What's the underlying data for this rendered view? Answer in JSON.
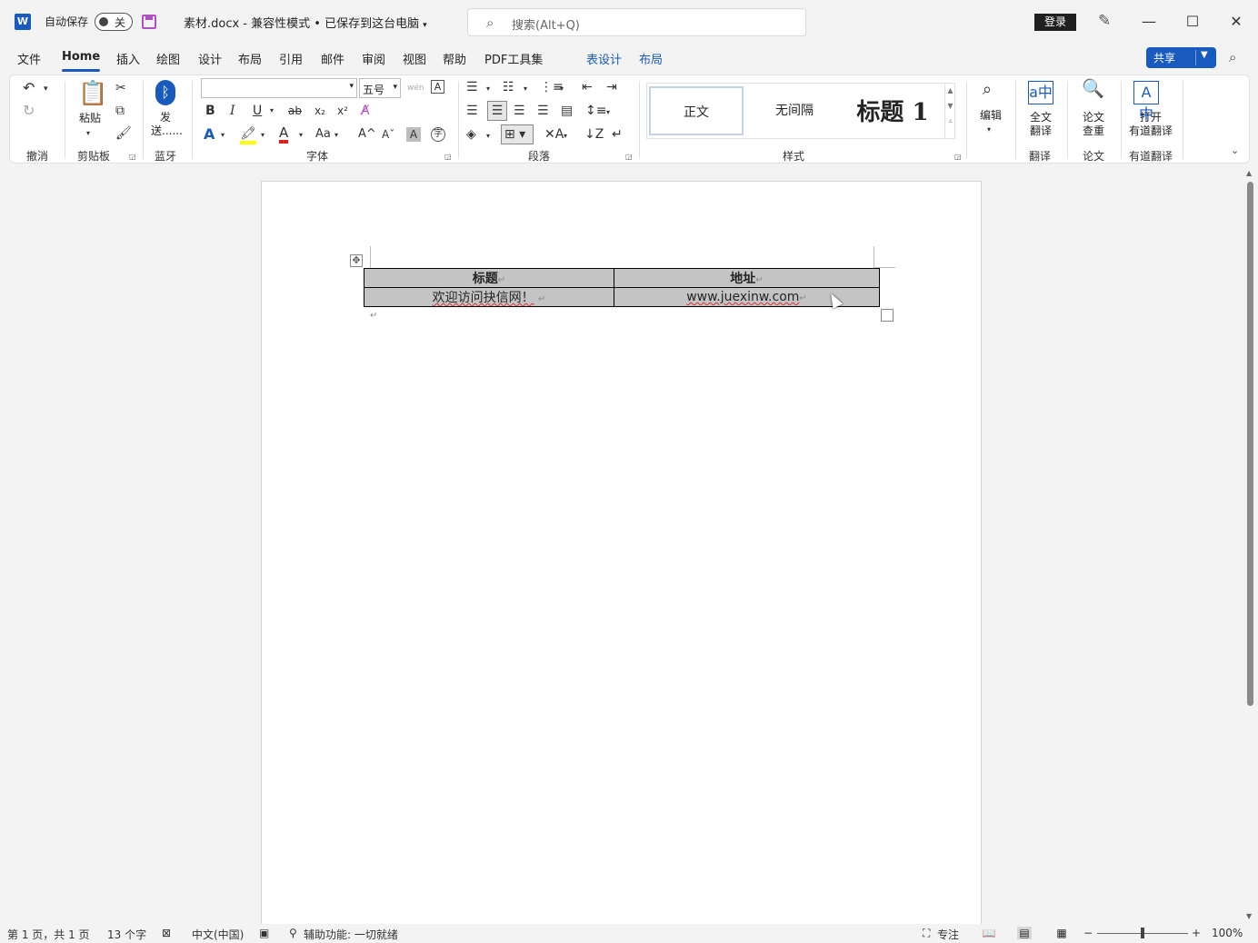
{
  "titlebar": {
    "logo": "W",
    "autosave_label": "自动保存",
    "autosave_state": "关",
    "doc_title": "素材.docx  -  兼容性模式 • 已保存到这台电脑",
    "search_placeholder": "搜索(Alt+Q)",
    "login_label": "登录"
  },
  "menu": {
    "items": [
      "文件",
      "Home",
      "插入",
      "绘图",
      "设计",
      "布局",
      "引用",
      "邮件",
      "审阅",
      "视图",
      "帮助",
      "PDF工具集",
      "表设计",
      "布局"
    ],
    "share_label": "共享"
  },
  "ribbon": {
    "groups": {
      "undo": "撤消",
      "clipboard": "剪贴板",
      "bluetooth": "蓝牙",
      "font": "字体",
      "paragraph": "段落",
      "styles": "样式",
      "translate": "翻译",
      "paper": "论文",
      "youdao": "有道翻译"
    },
    "paste_label": "粘贴",
    "send_label": "发\n送......",
    "font_size": "五号",
    "styles": [
      "正文",
      "无间隔",
      "标题 1"
    ],
    "edit_label": "编辑",
    "full_translate_label": "全文\n翻译",
    "paper_check_label": "论文\n查重",
    "open_youdao_label": "打开\n有道翻译"
  },
  "document": {
    "table": {
      "headers": [
        "标题",
        "地址"
      ],
      "rows": [
        [
          "欢迎访问抉信网！",
          "www.juexinw.com"
        ]
      ]
    }
  },
  "statusbar": {
    "page": "第 1 页，共 1 页",
    "words": "13 个字",
    "language": "中文(中国)",
    "accessibility": "辅助功能: 一切就绪",
    "focus": "专注",
    "zoom": "100%"
  }
}
